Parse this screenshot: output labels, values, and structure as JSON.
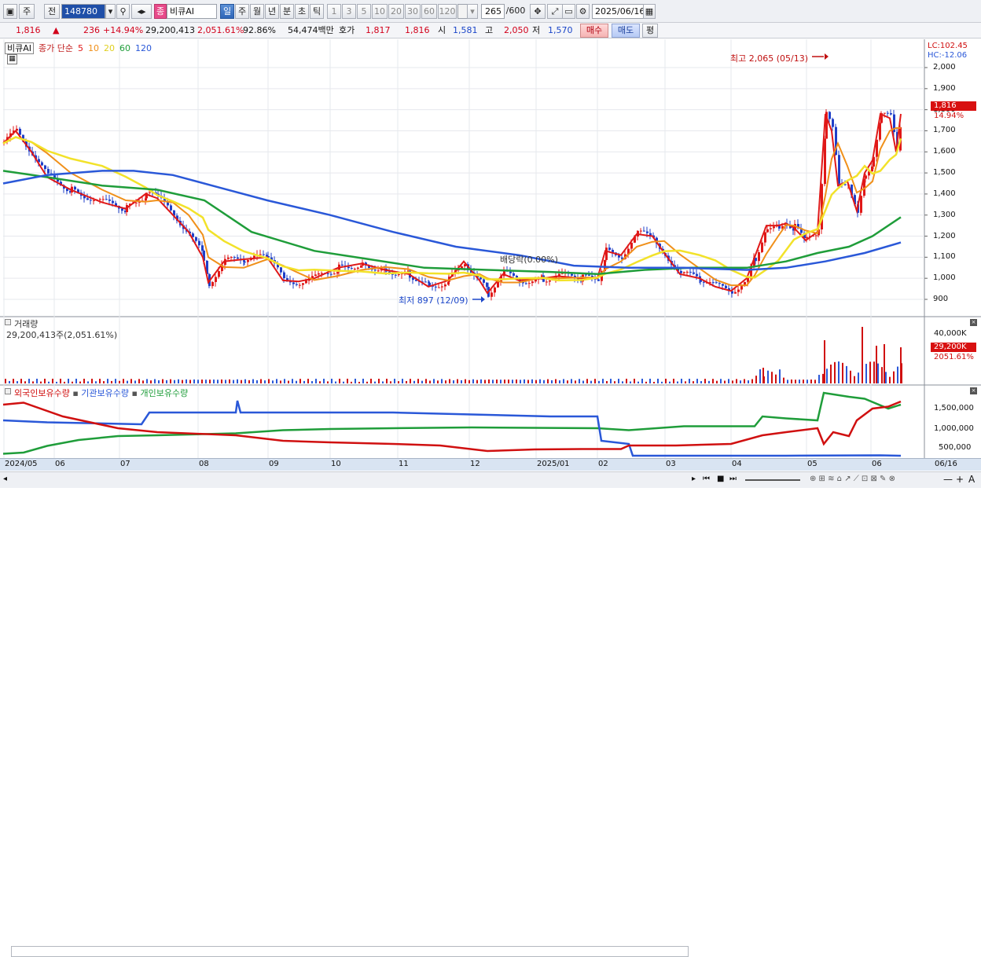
{
  "toolbar": {
    "period_label": "주",
    "market_label": "전",
    "code": "148780",
    "name_prefix": "종",
    "stock_name": "비큐AI",
    "tf_buttons": [
      "일",
      "주",
      "월",
      "년",
      "분",
      "초",
      "틱"
    ],
    "num_buttons": [
      "1",
      "3",
      "5",
      "10",
      "20",
      "30",
      "60",
      "120"
    ],
    "count": "265",
    "count_total": "/600",
    "date": "2025/06/16"
  },
  "info": {
    "price": "1,816",
    "arrow": "▲",
    "change": "236",
    "change_pct": "+14.94%",
    "volume": "29,200,413",
    "vol_pct": "2,051.61%",
    "ratio": "92.86%",
    "amount": "54,474백만",
    "quote_label": "호가",
    "ask": "1,817",
    "bid": "1,816",
    "open_label": "시",
    "open": "1,581",
    "high_label": "고",
    "high": "2,050",
    "low_label": "저",
    "low": "1,570",
    "buy_btn": "매수",
    "sell_btn": "매도",
    "eval_btn": "평"
  },
  "price_panel": {
    "stock": "비큐AI",
    "legend_title": "종가 단순",
    "ma": [
      {
        "label": "5",
        "color": "#e01818"
      },
      {
        "label": "10",
        "color": "#f0901a"
      },
      {
        "label": "20",
        "color": "#f2e22a"
      },
      {
        "label": "60",
        "color": "#1f9d3a"
      },
      {
        "label": "120",
        "color": "#2a58d8"
      }
    ],
    "lc": "LC:102.45",
    "hc": "HC:-12.06",
    "max_note": "최고 2,065 (05/13)",
    "min_note": "최저 897 (12/09)",
    "dividend_note": "배당락(0.00%)",
    "y_ticks": [
      "2,000",
      "1,900",
      "1,800",
      "1,700",
      "1,600",
      "1,500",
      "1,400",
      "1,300",
      "1,200",
      "1,100",
      "1,000",
      "900"
    ],
    "current_tag": "1,816",
    "current_pct": "14.94%"
  },
  "volume_panel": {
    "title": "거래량",
    "value": "29,200,413주(2,051.61%)",
    "y_tick": "40,000K",
    "tag": "29,200K",
    "tag_pct": "2051.61%"
  },
  "holding_panel": {
    "legend": [
      "외국인보유수량",
      "기관보유수량",
      "개인보유수량"
    ],
    "legend_colors": [
      "#d01010",
      "#2a58d8",
      "#1f9d3a"
    ],
    "y_ticks": [
      "1,500,000",
      "1,000,000",
      "500,000"
    ]
  },
  "x_axis": [
    "2024/05",
    "06",
    "07",
    "08",
    "09",
    "10",
    "11",
    "12",
    "2025/01",
    "02",
    "03",
    "04",
    "05",
    "06",
    "06/16"
  ],
  "chart_data": {
    "type": "line",
    "note": "candlestick price chart with moving averages; approximate values",
    "x": [
      "2024/05",
      "06",
      "07",
      "08",
      "09",
      "10",
      "11",
      "12",
      "2025/01",
      "02",
      "03",
      "04",
      "05",
      "06"
    ],
    "series": [
      {
        "name": "종가",
        "values": [
          1700,
          1450,
          1380,
          1050,
          1000,
          1050,
          1030,
          1000,
          1010,
          1150,
          980,
          1200,
          1500,
          1816
        ]
      }
    ],
    "ylim": [
      850,
      2100
    ]
  }
}
